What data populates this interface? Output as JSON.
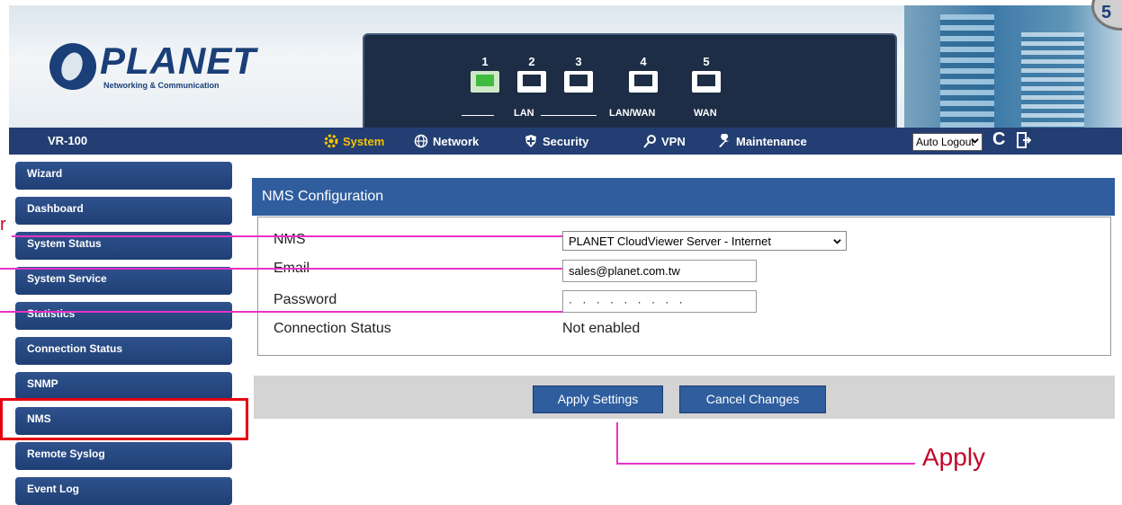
{
  "header": {
    "logo": "PLANET",
    "logo_sub": "Networking & Communication",
    "ports": [
      "1",
      "2",
      "3",
      "4",
      "5"
    ],
    "groups": [
      "LAN",
      "LAN/WAN",
      "WAN"
    ],
    "badge": "5"
  },
  "menubar": {
    "device": "VR-100",
    "items": [
      {
        "label": "System",
        "icon": "gear-icon",
        "active": true
      },
      {
        "label": "Network",
        "icon": "globe-icon"
      },
      {
        "label": "Security",
        "icon": "shield-icon"
      },
      {
        "label": "VPN",
        "icon": "key-icon"
      },
      {
        "label": "Maintenance",
        "icon": "wrench-icon"
      }
    ],
    "autologout": "Auto Logout",
    "refresh_glyph": "C"
  },
  "sidebar": {
    "items": [
      "Wizard",
      "Dashboard",
      "System Status",
      "System Service",
      "Statistics",
      "Connection Status",
      "SNMP",
      "NMS",
      "Remote Syslog",
      "Event Log"
    ],
    "selected": "NMS"
  },
  "nms": {
    "title": "NMS Configuration",
    "nms_label": "NMS",
    "nms_value": "PLANET CloudViewer Server - Internet",
    "email_label": "Email",
    "email_value": "sales@planet.com.tw",
    "password_label": "Password",
    "password_value": "· · · · · · · · ·",
    "status_label": "Connection Status",
    "status_value": "Not enabled"
  },
  "buttons": {
    "apply": "Apply Settings",
    "cancel": "Cancel Changes"
  },
  "annotations": {
    "apply": "Apply",
    "left_char": "r"
  },
  "colors": {
    "menubar": "#233e72",
    "active_menu": "#f5c400",
    "panel_header": "#2f5d9e",
    "highlight": "#e60012",
    "annotation_line": "#e832c8",
    "annotation_text": "#c0082b"
  }
}
